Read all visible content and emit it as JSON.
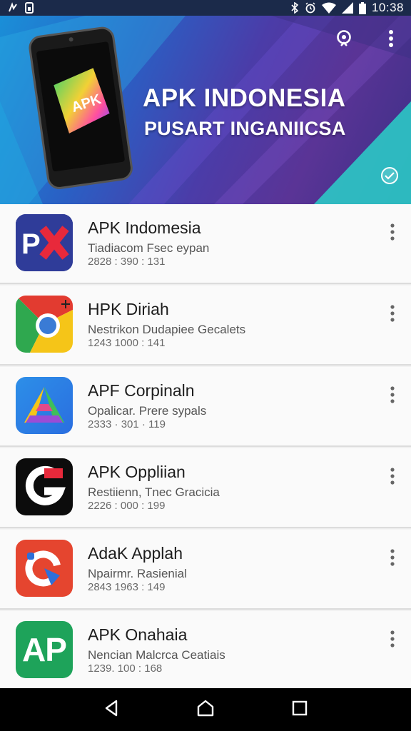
{
  "status_bar": {
    "time": "10:38",
    "icons": [
      "notification-icon",
      "sim-icon",
      "bluetooth-icon",
      "alarm-icon",
      "wifi-icon",
      "signal-icon",
      "battery-icon"
    ]
  },
  "header": {
    "title": "APK INDONESIA",
    "subtitle": "PUSART INGANIICSA",
    "phone_logo": "APK",
    "colors": {
      "gradient_start": "#1a8fd8",
      "gradient_mid": "#4b3ca8",
      "gradient_end": "#3b2f86",
      "teal_accent": "#2ad1c9"
    },
    "icons": [
      "search-icon",
      "more-vert-icon",
      "badge-icon"
    ]
  },
  "apps": [
    {
      "name": "APK Indomesia",
      "desc": "Tiadiacom Fsec eypan",
      "meta": "2828 : 390 : 131",
      "icon": "px-logo-icon"
    },
    {
      "name": "HPK Diriah",
      "desc": "Nestrikon Dudapiee Gecalets",
      "meta": "1243 1000 : 141",
      "icon": "chrome-logo-icon"
    },
    {
      "name": "APF Corpinaln",
      "desc": "Opalicar. Prere sypals",
      "meta": "2333 · 301 · 119",
      "icon": "triangle-logo-icon"
    },
    {
      "name": "APK Oppliian",
      "desc": "Restiienn, Tnec Gracicia",
      "meta": "2226 : 000 : 199",
      "icon": "g-logo-icon"
    },
    {
      "name": "AdaK Applah",
      "desc": "Npairmr. Rasienial",
      "meta": "2843 1963 : 149",
      "icon": "refresh-logo-icon"
    },
    {
      "name": "APK Onahaia",
      "desc": "Nencian  Malcrca Ceatiais",
      "meta": "1239. 100 : 168",
      "icon": "ap-logo-icon",
      "icon_text": "AP"
    }
  ],
  "nav_bar": {
    "icons": [
      "back-icon",
      "home-icon",
      "recents-icon"
    ]
  }
}
